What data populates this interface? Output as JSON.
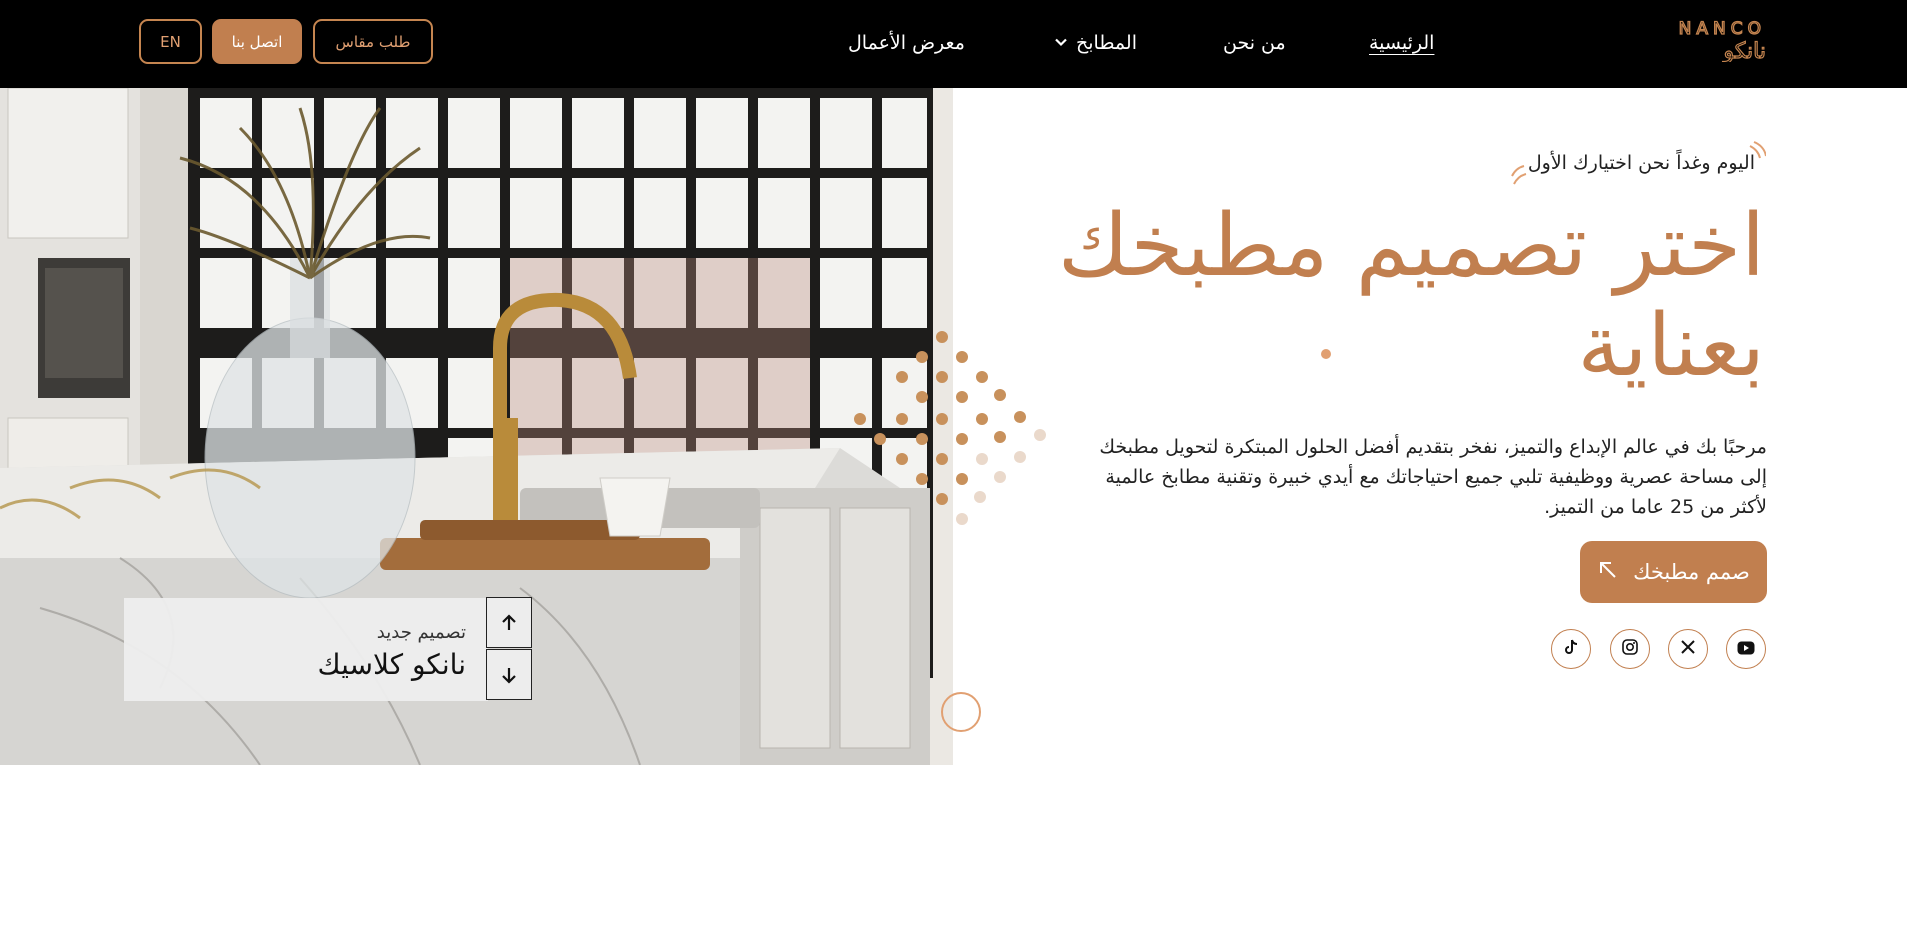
{
  "brand": {
    "name_latin": "NANCO",
    "name_arabic": "نانكو",
    "accent": "#c17f4f"
  },
  "nav": {
    "home": "الرئيسية",
    "about": "من نحن",
    "kitchens": "المطابخ",
    "portfolio": "معرض الأعمال"
  },
  "header_buttons": {
    "measure": "طلب مقاس",
    "contact": "اتصل بنا",
    "language": "EN"
  },
  "hero": {
    "tagline": "اليوم وغداً نحن اختيارك الأول",
    "title": "اختر تصميم مطبخك بعناية",
    "description": "مرحبًا بك في عالم الإبداع والتميز، نفخر بتقديم أفضل الحلول المبتكرة لتحويل مطبخك إلى مساحة عصرية ووظيفية تلبي جميع احتياجاتك مع أيدي خبيرة وتقنية مطابخ عالمية لأكثر من 25 عاما من التميز.",
    "cta_label": "صمم مطبخك"
  },
  "slide": {
    "subtitle": "تصميم جديد",
    "name": "نانكو كلاسيك"
  },
  "social": [
    "youtube-icon",
    "x-icon",
    "instagram-icon",
    "tiktok-icon"
  ]
}
